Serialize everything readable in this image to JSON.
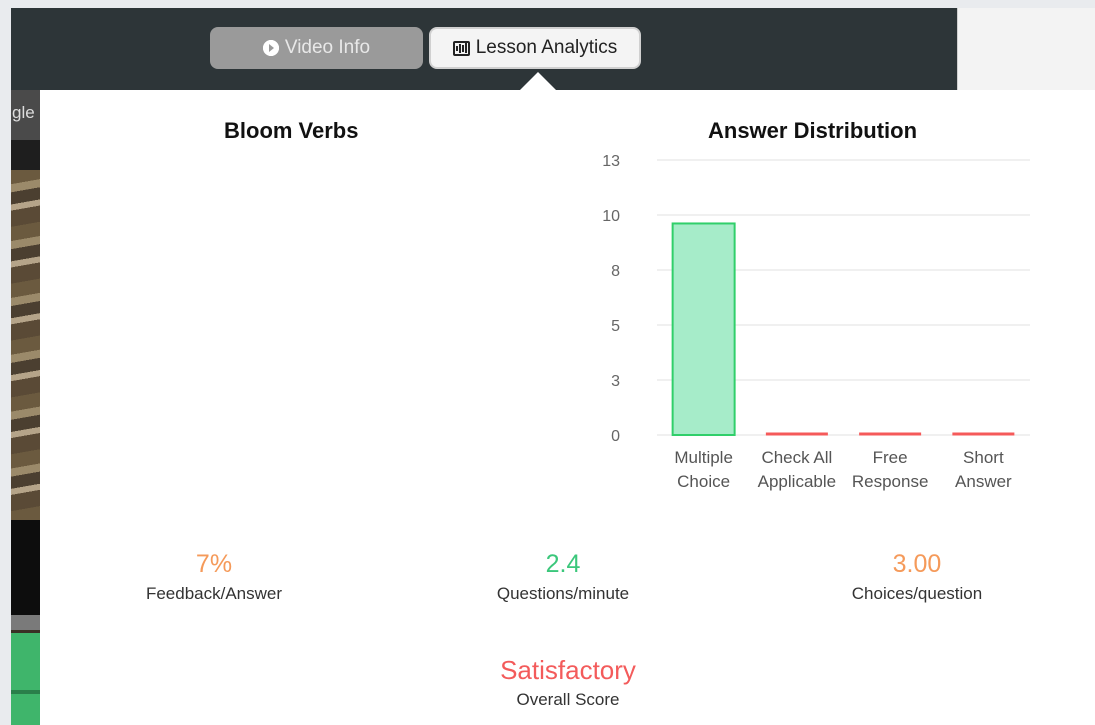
{
  "header": {
    "tabs": [
      {
        "label": "Video Info",
        "icon": "arrow-circle-icon",
        "active": false
      },
      {
        "label": "Lesson Analytics",
        "icon": "bar-chart-icon",
        "active": true
      }
    ]
  },
  "left_strip": {
    "partial_text": "gle"
  },
  "bloom": {
    "title": "Bloom Verbs"
  },
  "chart_data": {
    "type": "bar",
    "title": "Answer Distribution",
    "categories": [
      [
        "Multiple",
        "Choice"
      ],
      [
        "Check All",
        "Applicable"
      ],
      [
        "Free",
        "Response"
      ],
      [
        "Short",
        "Answer"
      ]
    ],
    "values": [
      10,
      0,
      0,
      0
    ],
    "ylim": [
      0,
      13
    ],
    "yticks": [
      "0",
      "3",
      "5",
      "8",
      "10",
      "13"
    ],
    "ytick_values": [
      0,
      2.6,
      5.2,
      7.8,
      10.4,
      13
    ],
    "bar_fill": "#a6ecc9",
    "bar_stroke": "#30cf6a",
    "zero_bar_color": "#f55a5a",
    "grid": true
  },
  "metrics": [
    {
      "value": "7%",
      "label": "Feedback/Answer",
      "color": "#f59a5a"
    },
    {
      "value": "2.4",
      "label": "Questions/minute",
      "color": "#3bc77b"
    },
    {
      "value": "3.00",
      "label": "Choices/question",
      "color": "#f59a5a"
    }
  ],
  "overall": {
    "value": "Satisfactory",
    "label": "Overall Score",
    "color": "#f35b5b"
  }
}
